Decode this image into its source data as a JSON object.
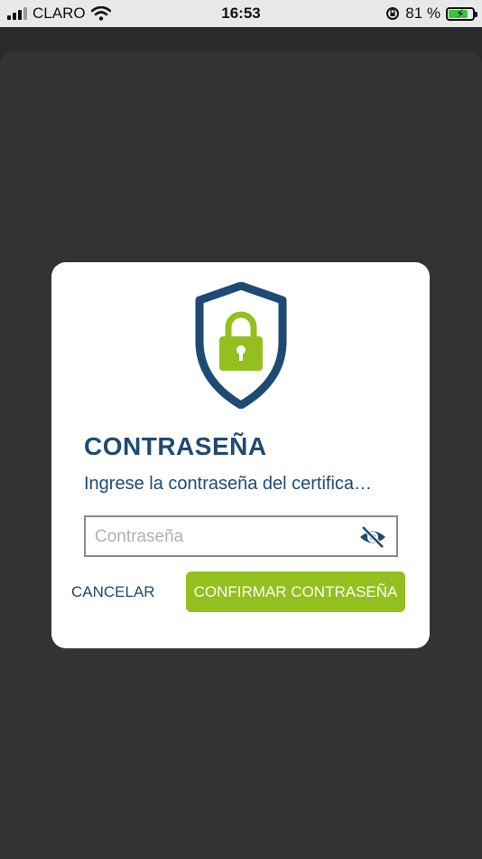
{
  "status_bar": {
    "carrier": "CLARO",
    "time": "16:53",
    "battery_percent": "81 %",
    "battery_level": 0.81
  },
  "dialog": {
    "title": "CONTRASEÑA",
    "subtitle": "Ingrese la contraseña del certifica…",
    "password_placeholder": "Contraseña",
    "password_value": "",
    "cancel_label": "CANCELAR",
    "confirm_label": "CONFIRMAR CONTRASEÑA",
    "icons": [
      "shield-lock-icon",
      "eye-slash-icon"
    ]
  },
  "colors": {
    "primary": "#1e4a73",
    "accent": "#93c01f",
    "overlay": "#333333"
  }
}
